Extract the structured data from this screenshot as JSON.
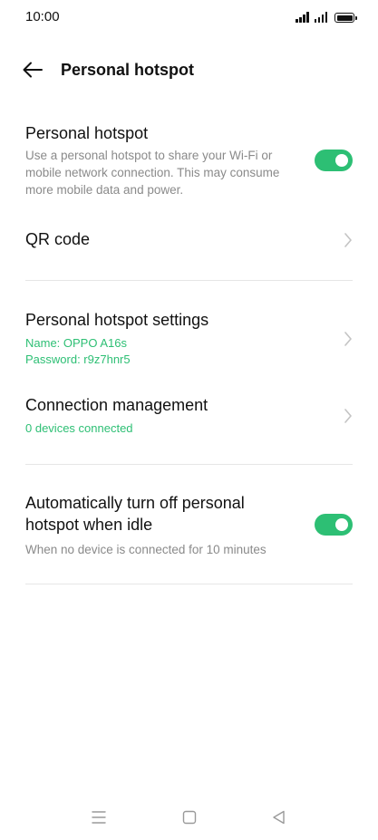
{
  "status_bar": {
    "time": "10:00"
  },
  "header": {
    "title": "Personal hotspot"
  },
  "hotspot": {
    "title": "Personal hotspot",
    "description": "Use a personal hotspot to share your Wi-Fi or mobile network connection. This may consume more mobile data and power.",
    "enabled": true
  },
  "qr_code": {
    "title": "QR code"
  },
  "settings": {
    "title": "Personal hotspot settings",
    "name_line": "Name: OPPO A16s",
    "password_line": "Password: r9z7hnr5"
  },
  "connection": {
    "title": "Connection management",
    "devices_line": "0 devices connected"
  },
  "auto_off": {
    "title": "Automatically turn off personal hotspot when idle",
    "description": "When no device is connected for 10 minutes",
    "enabled": true
  },
  "colors": {
    "accent": "#2dbf74",
    "divider": "#e6e6e6",
    "secondary_text": "#8a8a8a"
  },
  "icons": {
    "back": "arrow-left-icon",
    "chevron": "chevron-right-icon",
    "nav_menu": "menu-icon",
    "nav_home": "square-home-icon",
    "nav_back": "triangle-back-icon"
  }
}
